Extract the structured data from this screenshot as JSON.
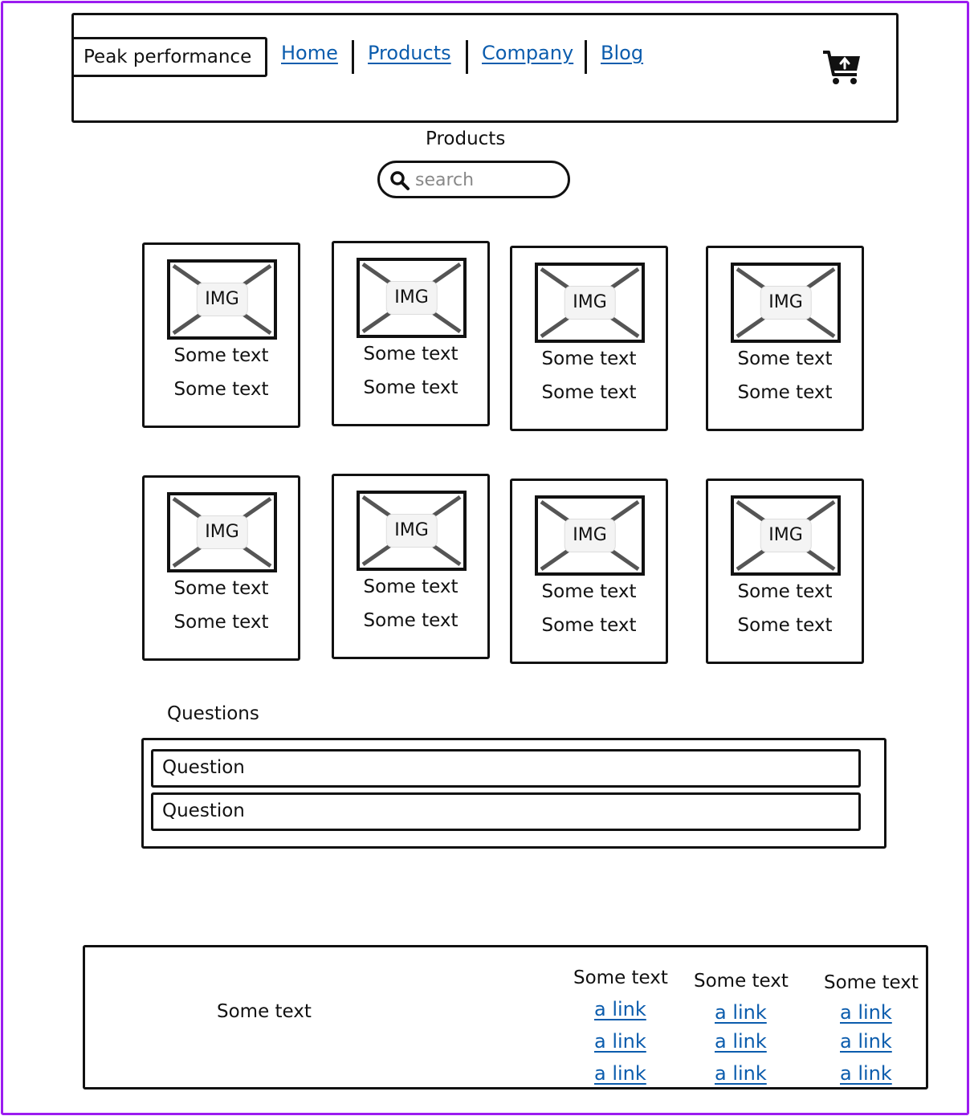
{
  "header": {
    "brand": "Peak performance",
    "nav": [
      "Home",
      "Products",
      "Company",
      "Blog"
    ],
    "cart_icon": "shopping-cart-upload-icon"
  },
  "products_section": {
    "title": "Products",
    "search_placeholder": "search",
    "search_icon": "search-icon",
    "cards": [
      {
        "img": "IMG",
        "line1": "Some text",
        "line2": "Some text"
      },
      {
        "img": "IMG",
        "line1": "Some text",
        "line2": "Some text"
      },
      {
        "img": "IMG",
        "line1": "Some text",
        "line2": "Some text"
      },
      {
        "img": "IMG",
        "line1": "Some text",
        "line2": "Some text"
      },
      {
        "img": "IMG",
        "line1": "Some text",
        "line2": "Some text"
      },
      {
        "img": "IMG",
        "line1": "Some text",
        "line2": "Some text"
      },
      {
        "img": "IMG",
        "line1": "Some text",
        "line2": "Some text"
      },
      {
        "img": "IMG",
        "line1": "Some text",
        "line2": "Some text"
      }
    ]
  },
  "questions_section": {
    "title": "Questions",
    "items": [
      "Question",
      "Question"
    ]
  },
  "footer": {
    "text": "Some text",
    "columns": [
      {
        "heading": "Some text",
        "links": [
          "a link",
          "a link",
          "a link"
        ]
      },
      {
        "heading": "Some text",
        "links": [
          "a link",
          "a link",
          "a link"
        ]
      },
      {
        "heading": "Some text",
        "links": [
          "a link",
          "a link",
          "a link"
        ]
      }
    ]
  },
  "colors": {
    "frame": "#9b1cf0",
    "link": "#0b5cad",
    "stroke": "#111111"
  }
}
